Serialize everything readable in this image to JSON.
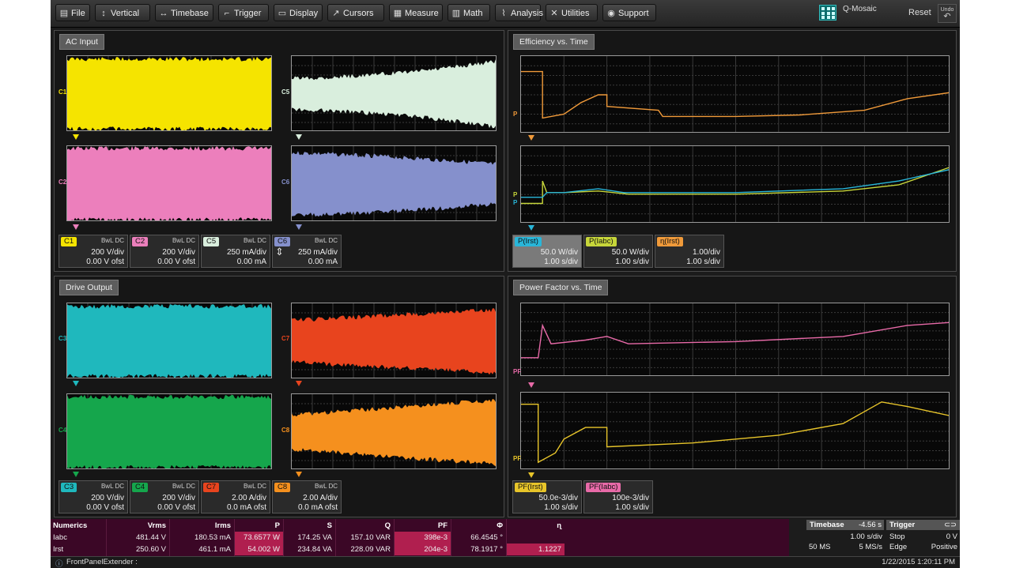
{
  "menu": {
    "items": [
      {
        "label": "File",
        "icon": "file-icon",
        "glyph": "▤"
      },
      {
        "label": "Vertical",
        "icon": "vertical-arrows-icon",
        "glyph": "↕"
      },
      {
        "label": "Timebase",
        "icon": "horizontal-arrows-icon",
        "glyph": "↔"
      },
      {
        "label": "Trigger",
        "icon": "trigger-icon",
        "glyph": "⌐"
      },
      {
        "label": "Display",
        "icon": "display-icon",
        "glyph": "▭"
      },
      {
        "label": "Cursors",
        "icon": "cursor-icon",
        "glyph": "↗"
      },
      {
        "label": "Measure",
        "icon": "measure-icon",
        "glyph": "▦"
      },
      {
        "label": "Math",
        "icon": "math-icon",
        "glyph": "▥"
      },
      {
        "label": "Analysis",
        "icon": "analysis-icon",
        "glyph": "⌇"
      },
      {
        "label": "Utilities",
        "icon": "utilities-icon",
        "glyph": "✕"
      },
      {
        "label": "Support",
        "icon": "support-icon",
        "glyph": "◉"
      }
    ],
    "qmosaic_label": "Q-Mosaic",
    "reset_label": "Reset",
    "undo_label": "Undo"
  },
  "panels": {
    "ac_input": "AC Input",
    "efficiency": "Efficiency vs. Time",
    "drive_output": "Drive Output",
    "power_factor": "Power Factor vs. Time"
  },
  "trace_labels": {
    "c1": "C1",
    "c5": "C5",
    "c2": "C2",
    "c6": "C6",
    "eff_p": "P",
    "eff_p2": "P",
    "eff_p3": "P",
    "c3": "C3",
    "c7": "C7",
    "c4": "C4",
    "c8": "C8",
    "pf1": "PF",
    "pf2": "PF"
  },
  "colors": {
    "c1": "#f5e400",
    "c2": "#ec7fbc",
    "c5": "#d9eedd",
    "c6": "#8590cc",
    "c3": "#1fb8bd",
    "c4": "#15a64c",
    "c7": "#e8441e",
    "c8": "#f5901e",
    "p_rst": "#29b6d9",
    "p_abc": "#c7d63a",
    "eta_rst": "#f09a3a",
    "pf_rst": "#e8c52a",
    "pf_abc": "#e86aa8"
  },
  "ac_descriptors": [
    {
      "tag": "C1",
      "coupling": "BwL DC",
      "scale": "200 V/div",
      "offset": "0.00 V ofst",
      "color": "#f5e400"
    },
    {
      "tag": "C2",
      "coupling": "BwL DC",
      "scale": "200 V/div",
      "offset": "0.00 V ofst",
      "color": "#ec7fbc"
    },
    {
      "tag": "C5",
      "coupling": "BwL DC",
      "scale": "250 mA/div",
      "offset": "0.00 mA",
      "color": "#d9eedd"
    },
    {
      "tag": "C6",
      "coupling": "BwL DC",
      "scale": "250 mA/div",
      "offset": "0.00 mA",
      "color": "#8590cc"
    }
  ],
  "eff_descriptors": [
    {
      "tag": "P(Irst)",
      "scale": "50.0 W/div",
      "timebase": "1.00 s/div",
      "color": "#29b6d9"
    },
    {
      "tag": "P(Iabc)",
      "scale": "50.0 W/div",
      "timebase": "1.00 s/div",
      "color": "#c7d63a"
    },
    {
      "tag": "ɳ(Irst)",
      "scale": "1.00/div",
      "timebase": "1.00 s/div",
      "color": "#f09a3a"
    }
  ],
  "drive_descriptors": [
    {
      "tag": "C3",
      "coupling": "BwL DC",
      "scale": "200 V/div",
      "offset": "0.00 V ofst",
      "color": "#1fb8bd"
    },
    {
      "tag": "C4",
      "coupling": "BwL DC",
      "scale": "200 V/div",
      "offset": "0.00 V ofst",
      "color": "#15a64c"
    },
    {
      "tag": "C7",
      "coupling": "BwL DC",
      "scale": "2.00 A/div",
      "offset": "0.0 mA ofst",
      "color": "#e8441e"
    },
    {
      "tag": "C8",
      "coupling": "BwL DC",
      "scale": "2.00 A/div",
      "offset": "0.0 mA ofst",
      "color": "#f5901e"
    }
  ],
  "pf_descriptors": [
    {
      "tag": "PF(Irst)",
      "scale": "50.0e-3/div",
      "timebase": "1.00 s/div",
      "color": "#e8c52a"
    },
    {
      "tag": "PF(Iabc)",
      "scale": "100e-3/div",
      "timebase": "1.00 s/div",
      "color": "#e86aa8"
    }
  ],
  "numerics": {
    "headers": [
      "Numerics",
      "Vrms",
      "Irms",
      "P",
      "S",
      "Q",
      "PF",
      "Φ",
      "ɳ"
    ],
    "rows": [
      [
        "Iabc",
        "481.44 V",
        "180.53 mA",
        "73.6577 W",
        "174.25 VA",
        "157.10 VAR",
        "398e-3",
        "66.4545 °",
        ""
      ],
      [
        "Irst",
        "250.60 V",
        "461.1 mA",
        "54.002 W",
        "234.84 VA",
        "228.09 VAR",
        "204e-3",
        "78.1917 °",
        "1.1227"
      ]
    ]
  },
  "timebase": {
    "label": "Timebase",
    "delay": "-4.56 s",
    "scale": "1.00 s/div",
    "samples": "50 MS",
    "rate": "5 MS/s"
  },
  "trigger": {
    "label": "Trigger",
    "mode": "Stop",
    "level": "0 V",
    "type": "Edge",
    "slope": "Positive"
  },
  "status": {
    "app": "FrontPanelExtender :",
    "datetime": "1/22/2015 1:20:11 PM"
  }
}
